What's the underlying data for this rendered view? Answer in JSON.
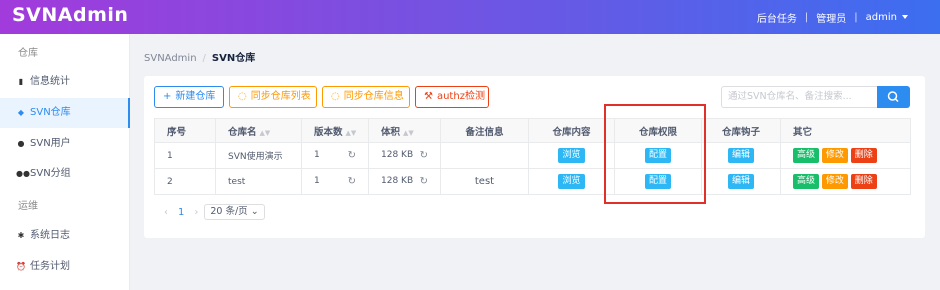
{
  "app": {
    "logo": "SVNAdmin"
  },
  "topbar": {
    "tasks": "后台任务",
    "role": "管理员",
    "user": "admin"
  },
  "sidebar": {
    "groups": [
      "仓库",
      "运维"
    ],
    "items": [
      {
        "label": "信息统计",
        "icon": "bar-chart-icon"
      },
      {
        "label": "SVN仓库",
        "icon": "stack-icon"
      },
      {
        "label": "SVN用户",
        "icon": "user-icon"
      },
      {
        "label": "SVN分组",
        "icon": "group-icon"
      },
      {
        "label": "系统日志",
        "icon": "bug-icon"
      },
      {
        "label": "任务计划",
        "icon": "alarm-icon"
      }
    ]
  },
  "breadcrumb": {
    "root": "SVNAdmin",
    "sep": "/",
    "current": "SVN仓库"
  },
  "toolbar": {
    "new_repo": "新建仓库",
    "sync_list": "同步仓库列表",
    "sync_info": "同步仓库信息",
    "authz": "authz检测",
    "search_placeholder": "通过SVN仓库名、备注搜索..."
  },
  "table": {
    "headers": [
      "序号",
      "仓库名",
      "版本数",
      "体积",
      "备注信息",
      "仓库内容",
      "仓库权限",
      "仓库钩子",
      "其它"
    ],
    "rows": [
      {
        "index": "1",
        "name": "SVN使用演示",
        "rev": "1",
        "size": "128 KB",
        "note": ""
      },
      {
        "index": "2",
        "name": "test",
        "rev": "1",
        "size": "128 KB",
        "note": "test"
      }
    ],
    "actions": {
      "browse": "浏览",
      "config": "配置",
      "edit": "编辑",
      "advanced": "高级",
      "modify": "修改",
      "delete": "删除"
    }
  },
  "pager": {
    "prev": "‹",
    "page": "1",
    "next": "›",
    "page_size": "20 条/页"
  },
  "colors": {
    "primary": "#2d8cf0",
    "warning": "#ff9900",
    "danger": "#ed4014",
    "success": "#19be6b",
    "info": "#2db7f5",
    "highlight": "#e0302a"
  }
}
